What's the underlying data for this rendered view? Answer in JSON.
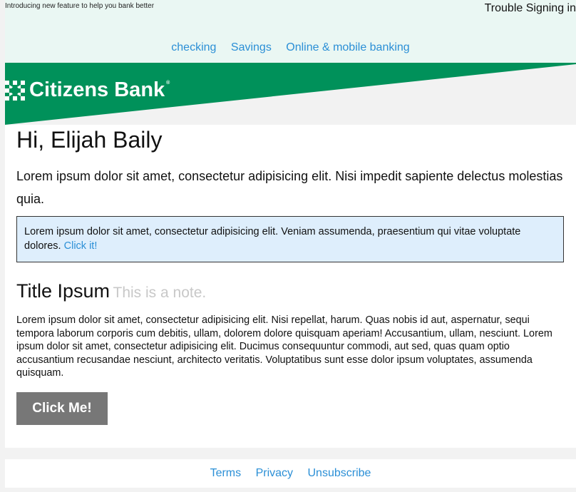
{
  "header": {
    "preheader": "Introducing new feature to help you bank better",
    "trouble_link": "Trouble Signing in",
    "nav": [
      "checking",
      "Savings",
      "Online & mobile banking"
    ]
  },
  "brand": {
    "name": "Citizens Bank",
    "trademark": "®",
    "color": "#00915a"
  },
  "main": {
    "greeting": "Hi, Elijah Baily",
    "intro": "Lorem ipsum dolor sit amet, consectetur adipisicing elit. Nisi impedit sapiente delectus molestias quia.",
    "notice_text": "Lorem ipsum dolor sit amet, consectetur adipisicing elit. Veniam assumenda, praesentium qui vitae voluptate dolores. ",
    "notice_link": "Click it!",
    "title": "Title Ipsum",
    "note": "This is a note.",
    "body": "Lorem ipsum dolor sit amet, consectetur adipisicing elit. Nisi repellat, harum. Quas nobis id aut, aspernatur, sequi tempora laborum corporis cum debitis, ullam, dolorem dolore quisquam aperiam! Accusantium, ullam, nesciunt. Lorem ipsum dolor sit amet, consectetur adipisicing elit. Ducimus consequuntur commodi, aut sed, quas quam optio accusantium recusandae nesciunt, architecto veritatis. Voluptatibus sunt esse dolor ipsum voluptates, assumenda quisquam.",
    "button_label": "Click Me!"
  },
  "footer": {
    "links": [
      "Terms",
      "Privacy",
      "Unsubscribe"
    ]
  },
  "colors": {
    "link": "#2b8fd6",
    "header_bg": "#eaf7f3",
    "notice_bg": "#deeefc",
    "button_bg": "#777777"
  }
}
